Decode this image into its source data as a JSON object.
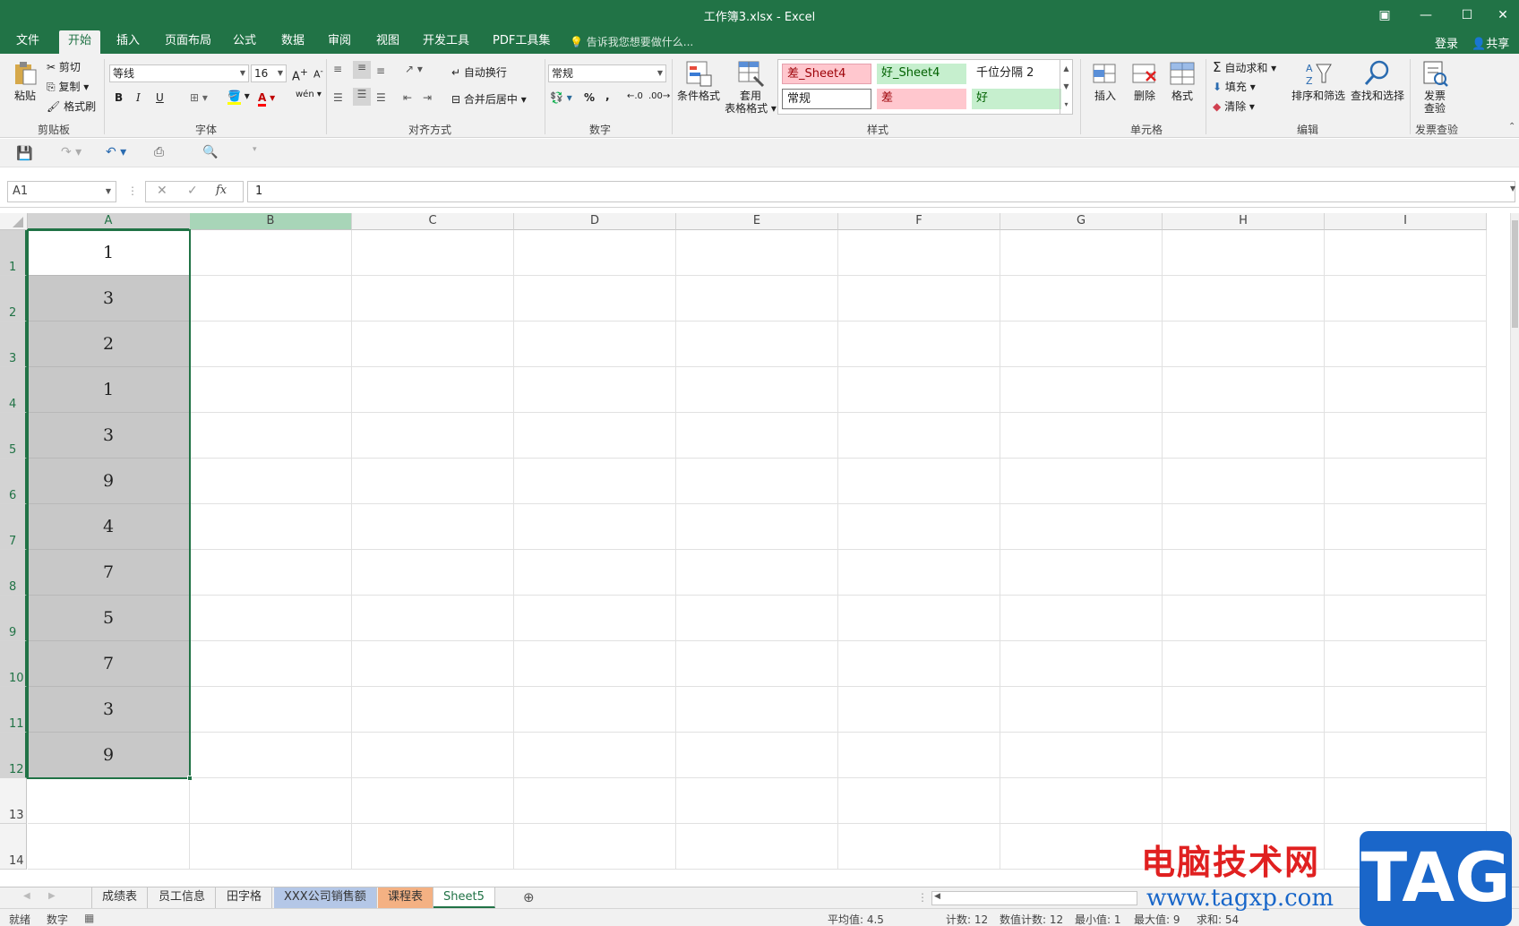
{
  "window": {
    "title": "工作簿3.xlsx - Excel"
  },
  "tabs": [
    "文件",
    "开始",
    "插入",
    "页面布局",
    "公式",
    "数据",
    "审阅",
    "视图",
    "开发工具",
    "PDF工具集"
  ],
  "tell_me": "告诉我您想要做什么...",
  "login": "登录",
  "share": "共享",
  "ribbon": {
    "clipboard": {
      "paste": "粘贴",
      "cut": "剪切",
      "copy": "复制",
      "format_painter": "格式刷",
      "label": "剪贴板"
    },
    "font": {
      "name": "等线",
      "size": "16",
      "bold": "B",
      "italic": "I",
      "underline": "U",
      "label": "字体"
    },
    "alignment": {
      "wrap": "自动换行",
      "merge": "合并后居中",
      "label": "对齐方式"
    },
    "number": {
      "format": "常规",
      "label": "数字"
    },
    "styles": {
      "conditional": "条件格式",
      "table_format_1": "套用",
      "table_format_2": "表格格式",
      "cells": [
        "差_Sheet4",
        "好_Sheet4",
        "千位分隔 2",
        "常规",
        "差",
        "好"
      ],
      "label": "样式"
    },
    "cells_group": {
      "insert": "插入",
      "delete": "删除",
      "format": "格式",
      "label": "单元格"
    },
    "editing": {
      "autosum": "自动求和",
      "fill": "填充",
      "clear": "清除",
      "sort": "排序和筛选",
      "find": "查找和选择",
      "label": "编辑"
    },
    "invoice": {
      "btn_1": "发票",
      "btn_2": "查验",
      "label": "发票查验"
    }
  },
  "formula_bar": {
    "name_box": "A1",
    "value": "1",
    "fx": "fx"
  },
  "columns": [
    "A",
    "B",
    "C",
    "D",
    "E",
    "F",
    "G",
    "H",
    "I"
  ],
  "rows": [
    "1",
    "2",
    "3",
    "4",
    "5",
    "6",
    "7",
    "8",
    "9",
    "10",
    "11",
    "12",
    "13",
    "14"
  ],
  "column_a_values": [
    "1",
    "3",
    "2",
    "1",
    "3",
    "9",
    "4",
    "7",
    "5",
    "7",
    "3",
    "9"
  ],
  "sheets": [
    "成绩表",
    "员工信息",
    "田字格",
    "XXX公司销售额",
    "课程表",
    "Sheet5"
  ],
  "status": {
    "ready": "就绪",
    "mode": "数字",
    "average": "平均值: 4.5",
    "count": "计数: 12",
    "numeric_count": "数值计数: 12",
    "min": "最小值: 1",
    "max": "最大值: 9",
    "sum": "求和: 54"
  },
  "watermark": {
    "text": "电脑技术网",
    "url": "www.tagxp.com",
    "logo": "TAG"
  },
  "colors": {
    "accent": "#217346",
    "selection_fill": "#c8c8c8",
    "bad_style": "#ffc7ce",
    "good_style": "#c6efce"
  }
}
